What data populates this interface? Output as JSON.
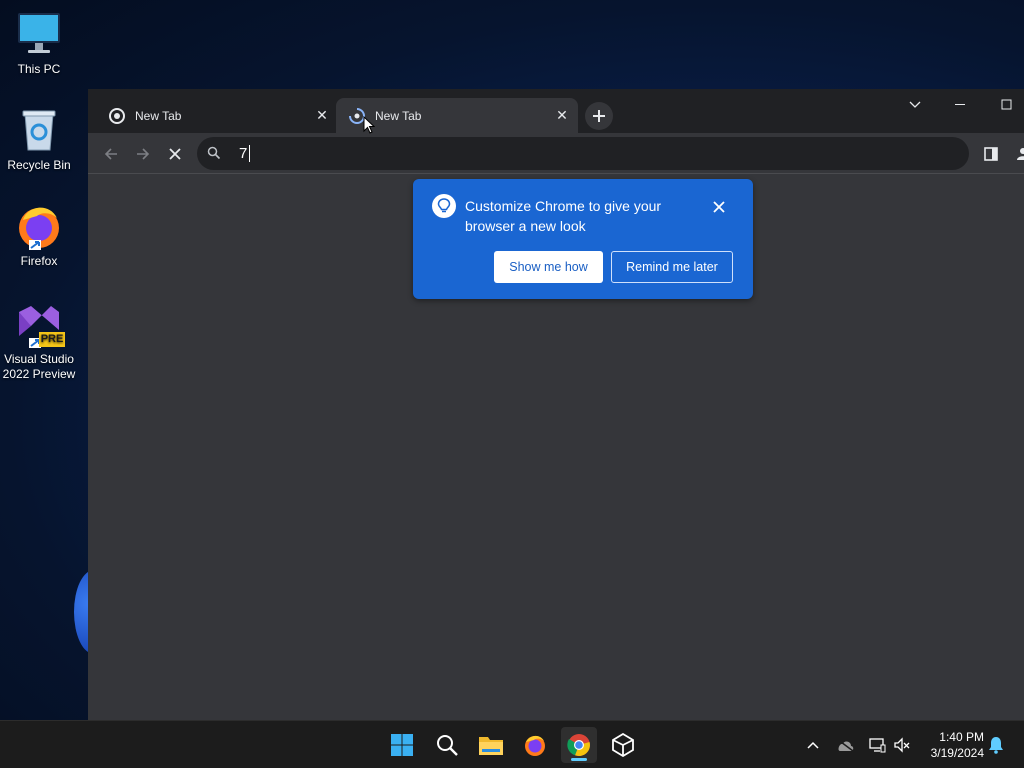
{
  "desktop": {
    "icons": [
      {
        "label": "This PC"
      },
      {
        "label": "Recycle Bin"
      },
      {
        "label": "Firefox"
      },
      {
        "label": "Visual Studio 2022 Preview"
      }
    ],
    "vs_badge": "PRE"
  },
  "browser": {
    "tabs": [
      {
        "title": "New Tab",
        "active": false,
        "close": "✕"
      },
      {
        "title": "New Tab",
        "active": true,
        "close": "✕"
      }
    ],
    "omnibox": {
      "value": "7"
    },
    "promo": {
      "message": "Customize Chrome to give your browser a new look",
      "primary_button": "Show me how",
      "secondary_button": "Remind me later"
    }
  },
  "taskbar": {
    "apps": [
      "start-icon",
      "search-icon",
      "file-explorer-icon",
      "firefox-icon",
      "chrome-icon",
      "unity-icon"
    ],
    "active_app": "chrome-icon",
    "clock": {
      "time": "1:40 PM",
      "date": "3/19/2024"
    }
  },
  "colors": {
    "promo_bg": "#1a66d2",
    "browser_bg": "#35363a",
    "tabstrip_bg": "#202124",
    "taskbar_bg": "#1c1c1c"
  }
}
